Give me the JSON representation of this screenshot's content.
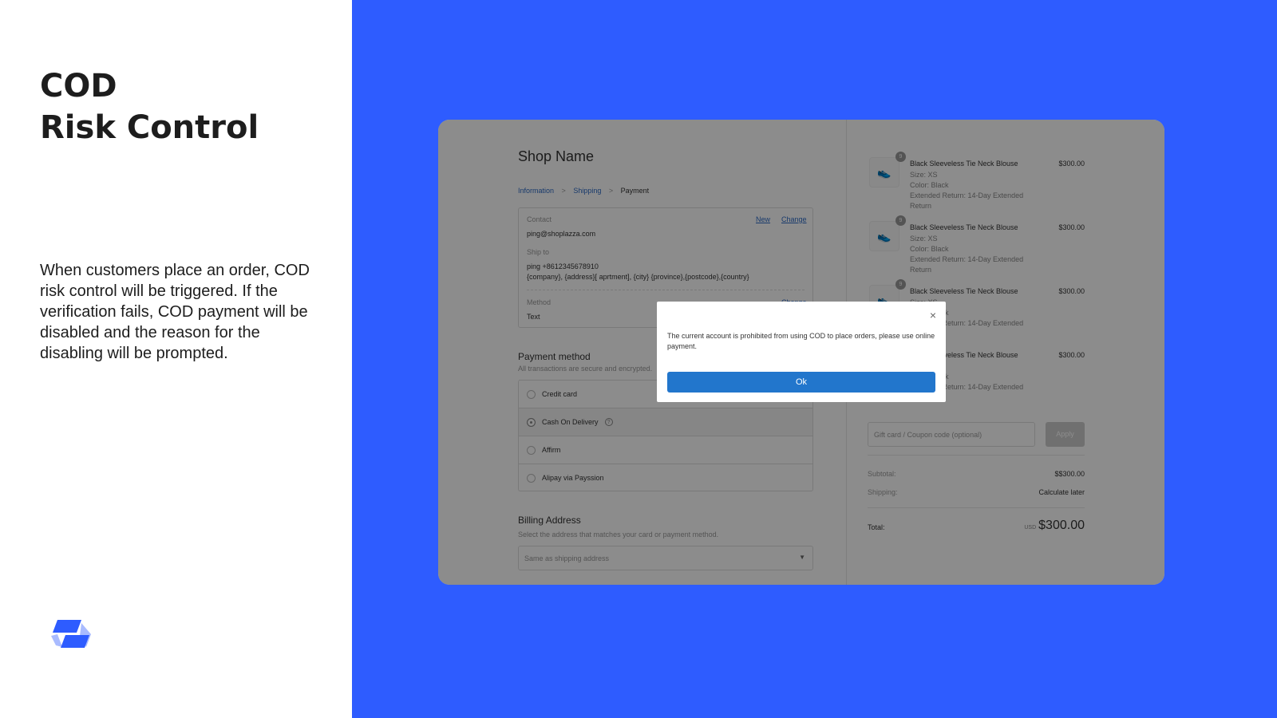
{
  "slide": {
    "title_line1": "COD",
    "title_line2": "Risk Control",
    "description": "When customers place an order, COD risk control will be triggered. If the verification fails, COD payment will be disabled and the reason for the disabling will be prompted.",
    "accent": "#2e5cff"
  },
  "checkout": {
    "shop_name": "Shop Name",
    "breadcrumb": [
      "Information",
      "Shipping",
      "Payment"
    ],
    "contact_label": "Contact",
    "contact_new": "New",
    "contact_change": "Change",
    "contact_value": "ping@shoplazza.com",
    "ship_to_label": "Ship to",
    "ship_to_line1": "ping +8612345678910",
    "ship_to_line2": "{company}, {address}[ aprtment], {city} {province},{postcode},{country}",
    "method_label": "Method",
    "method_change": "Change",
    "method_value": "Text",
    "payment_title": "Payment method",
    "payment_sub": "All transactions are secure and encrypted.",
    "payment_options": [
      {
        "label": "Credit card",
        "selected": false
      },
      {
        "label": "Cash On Delivery",
        "selected": true
      },
      {
        "label": "Affirm",
        "selected": false
      },
      {
        "label": "Alipay via Payssion",
        "selected": false
      }
    ],
    "billing_title": "Billing Address",
    "billing_sub": "Select the address that matches your card or payment method.",
    "billing_select": "Same as shipping address",
    "items": [
      {
        "qty": "9",
        "name": "Black Sleeveless Tie Neck Blouse",
        "size": "Size: XS",
        "color": "Color: Black",
        "extended": "Extended Return: 14-Day Extended Return",
        "price": "$300.00"
      },
      {
        "qty": "9",
        "name": "Black Sleeveless Tie Neck Blouse",
        "size": "Size: XS",
        "color": "Color: Black",
        "extended": "Extended Return: 14-Day Extended Return",
        "price": "$300.00"
      },
      {
        "qty": "9",
        "name": "Black Sleeveless Tie Neck Blouse",
        "size": "Size: XS",
        "color": "Color: Black",
        "extended": "Extended Return: 14-Day Extended Return",
        "price": "$300.00"
      },
      {
        "qty": "9",
        "name": "Black Sleeveless Tie Neck Blouse",
        "size": "Size: XS",
        "color": "Color: Black",
        "extended": "Extended Return: 14-Day Extended Return",
        "price": "$300.00"
      }
    ],
    "coupon_placeholder": "Gift card / Coupon code (optional)",
    "apply": "Apply",
    "subtotal_label": "Subtotal:",
    "subtotal": "$$300.00",
    "shipping_label": "Shipping:",
    "shipping": "Calculate later",
    "total_label": "Total:",
    "currency": "USD",
    "total": "$300.00"
  },
  "modal": {
    "message": "The current account is prohibited from using COD to place orders, please use online payment.",
    "ok": "Ok",
    "button_color": "#2276cc"
  }
}
